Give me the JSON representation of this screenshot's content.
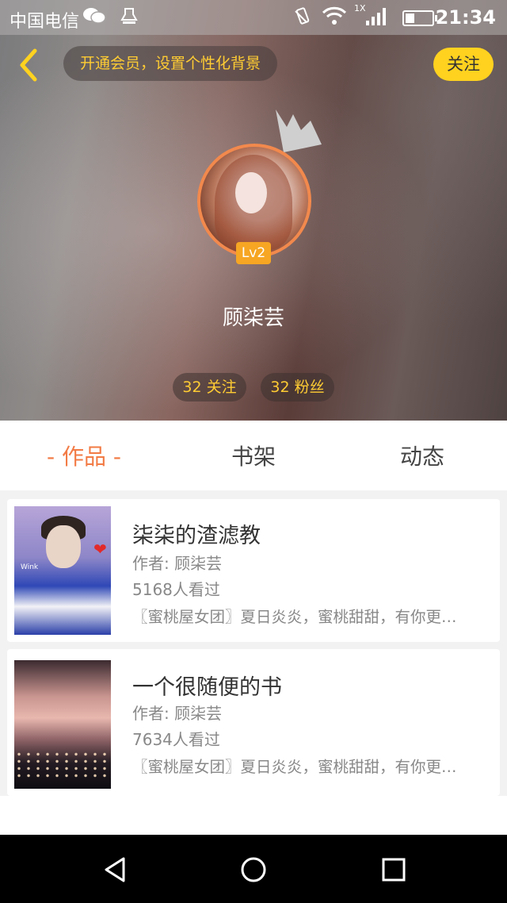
{
  "status_bar": {
    "carrier": "中国电信",
    "signal_label": "1X",
    "time": "21:34",
    "battery_level": 0.35,
    "icons": [
      "wechat-icon",
      "notification-icon",
      "vibrate-icon",
      "wifi-icon",
      "signal-icon",
      "battery-icon"
    ]
  },
  "header": {
    "back_icon": "chevron-left-icon",
    "promo_text": "开通会员，设置个性化背景",
    "follow_label": "关注"
  },
  "profile": {
    "name": "顾柒芸",
    "level": "Lv2",
    "following": "32 关注",
    "fans": "32 粉丝"
  },
  "tabs": [
    {
      "label": "- 作品 -",
      "active": true
    },
    {
      "label": "书架",
      "active": false
    },
    {
      "label": "动态",
      "active": false
    }
  ],
  "works": [
    {
      "title": "柒柒的渣滤教",
      "author": "作者: 顾柒芸",
      "views": "5168人看过",
      "desc": "〖蜜桃屋女团〗夏日炎炎，蜜桃甜甜，有你更…",
      "cover_text": "Wink"
    },
    {
      "title": "一个很随便的书",
      "author": "作者: 顾柒芸",
      "views": "7634人看过",
      "desc": "〖蜜桃屋女团〗夏日炎炎，蜜桃甜甜，有你更…"
    }
  ],
  "colors": {
    "accent": "#f27b45",
    "yellow": "#ffd21f",
    "gold_text": "#ffcc33",
    "level_badge": "#f6a623"
  },
  "nav_icons": [
    "back-triangle-icon",
    "home-circle-icon",
    "recents-square-icon"
  ]
}
